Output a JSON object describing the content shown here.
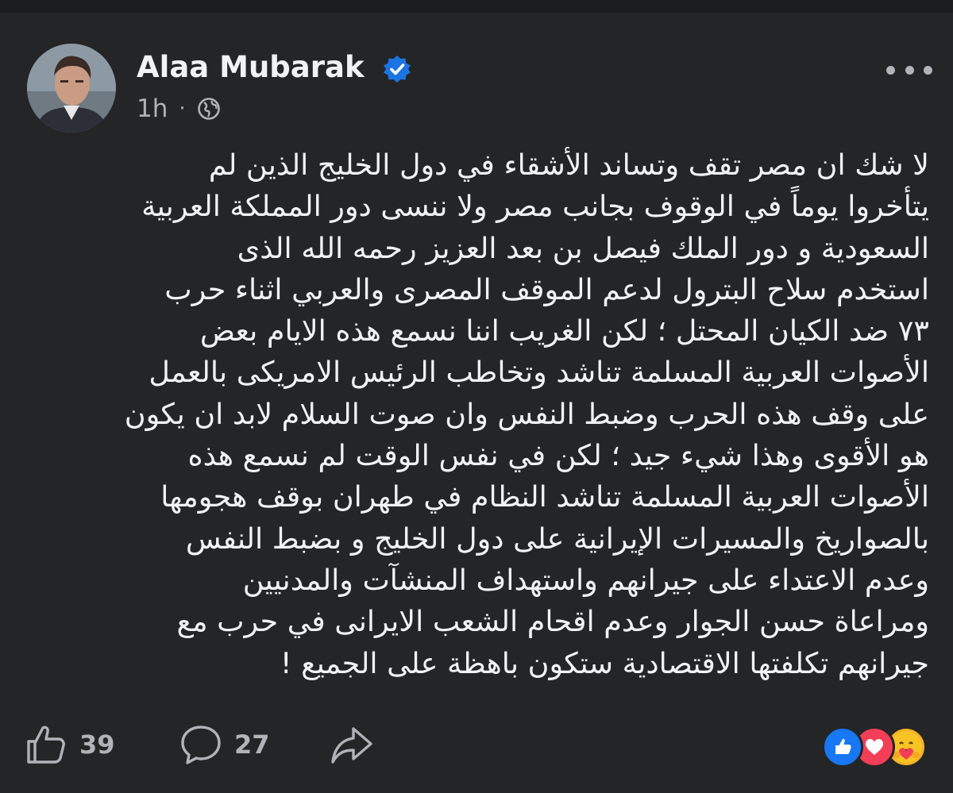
{
  "post": {
    "author": {
      "name": "Alaa Mubarak",
      "verified": true
    },
    "timestamp": "1h",
    "separator": "·",
    "audience_icon": "globe-icon",
    "text_lines": [
      "لا شك ان مصر تقف وتساند الأشقاء في دول الخليج الذين لم",
      "يتأخروا يوماً في الوقوف بجانب مصر ولا ننسى دور المملكة العربية",
      "السعودية و دور الملك فيصل بن بعد العزيز رحمه الله الذى",
      "استخدم سلاح البترول لدعم الموقف المصرى والعربي اثناء حرب",
      "٧٣ ضد الكيان المحتل ؛ لكن الغريب اننا نسمع هذه الايام بعض",
      "الأصوات العربية المسلمة تناشد وتخاطب الرئيس الامريكى بالعمل",
      "على وقف هذه الحرب وضبط النفس وان صوت السلام لابد ان يكون",
      "هو  الأقوى وهذا شيء جيد ؛ لكن في نفس الوقت لم  نسمع هذه",
      "الأصوات العربية المسلمة تناشد النظام في طهران بوقف هجومها",
      "بالصواريخ والمسيرات الإيرانية على دول الخليج و بضبط النفس",
      "وعدم الاعتداء على جيرانهم واستهداف المنشآت والمدنيين",
      "ومراعاة حسن الجوار وعدم اقحام الشعب الايرانى في حرب مع",
      "جيرانهم تكلفتها الاقتصادية ستكون باهظة على الجميع !"
    ]
  },
  "actions": {
    "likes": "39",
    "comments": "27"
  },
  "icons": {
    "like": "thumbs-up-icon",
    "comment": "comment-bubble-icon",
    "share": "share-arrow-icon",
    "more": "more-options-icon"
  },
  "reactions": [
    "like-reaction-icon",
    "love-reaction-icon",
    "care-reaction-icon"
  ],
  "colors": {
    "background": "#242526",
    "text": "#f0f2f5",
    "secondary_text": "#b0b3b8",
    "verified_blue": "#1b74e4",
    "like_blue": "#1877f2",
    "love_red": "#f33e58",
    "care_yellow": "#f7b125"
  }
}
